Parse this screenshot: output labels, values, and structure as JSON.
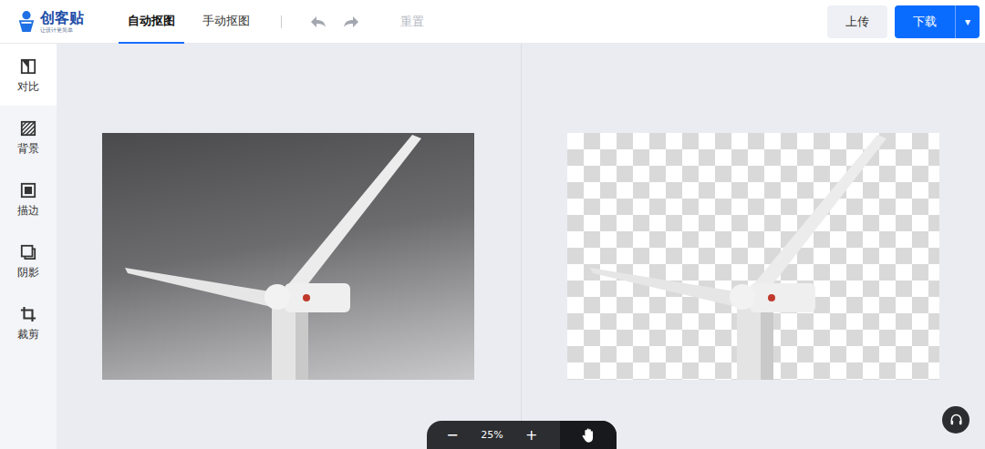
{
  "logo": {
    "name": "创客贴",
    "tagline": "让设计更简单"
  },
  "tabs": [
    {
      "label": "自动抠图",
      "selected": true
    },
    {
      "label": "手动抠图",
      "selected": false
    }
  ],
  "toolbar": {
    "undo": {
      "disabled": true
    },
    "redo": {
      "disabled": true
    },
    "reset": {
      "label": "重置",
      "disabled": true
    }
  },
  "actions": {
    "upload": "上传",
    "download": "下载",
    "download_menu": "▾"
  },
  "sidebar": {
    "items": [
      {
        "label": "对比",
        "selected": true
      },
      {
        "label": "背景",
        "selected": false
      },
      {
        "label": "描边",
        "selected": false
      },
      {
        "label": "阴影",
        "selected": false
      },
      {
        "label": "裁剪",
        "selected": false
      }
    ]
  },
  "zoom": {
    "minus": "−",
    "value": "25%",
    "plus": "+",
    "hand_selected": true
  }
}
